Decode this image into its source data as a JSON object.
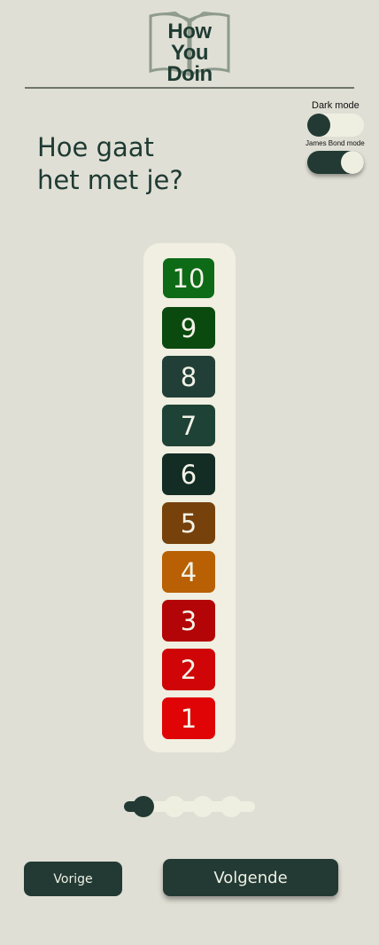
{
  "header": {
    "logo_line1": "How You",
    "logo_line2": "Doin"
  },
  "toggles": {
    "dark_mode": {
      "label": "Dark mode",
      "on": false
    },
    "bond_mode": {
      "label": "James Bond mode",
      "on": true
    }
  },
  "question": {
    "line1": "Hoe gaat",
    "line2": "het met je?"
  },
  "scale": [
    {
      "value": "10",
      "color": "#0d6a16"
    },
    {
      "value": "9",
      "color": "#0b4a0f"
    },
    {
      "value": "8",
      "color": "#213f37"
    },
    {
      "value": "7",
      "color": "#1f4236"
    },
    {
      "value": "6",
      "color": "#132d25"
    },
    {
      "value": "5",
      "color": "#77410c"
    },
    {
      "value": "4",
      "color": "#b86003"
    },
    {
      "value": "3",
      "color": "#b30407"
    },
    {
      "value": "2",
      "color": "#cf0507"
    },
    {
      "value": "1",
      "color": "#e00406"
    }
  ],
  "progress": {
    "current_step": 1,
    "total_steps": 4
  },
  "nav": {
    "prev_label": "Vorige",
    "next_label": "Volgende"
  },
  "colors": {
    "background": "#dfdfd5",
    "primary": "#223a33",
    "surface": "#f0efe1"
  }
}
